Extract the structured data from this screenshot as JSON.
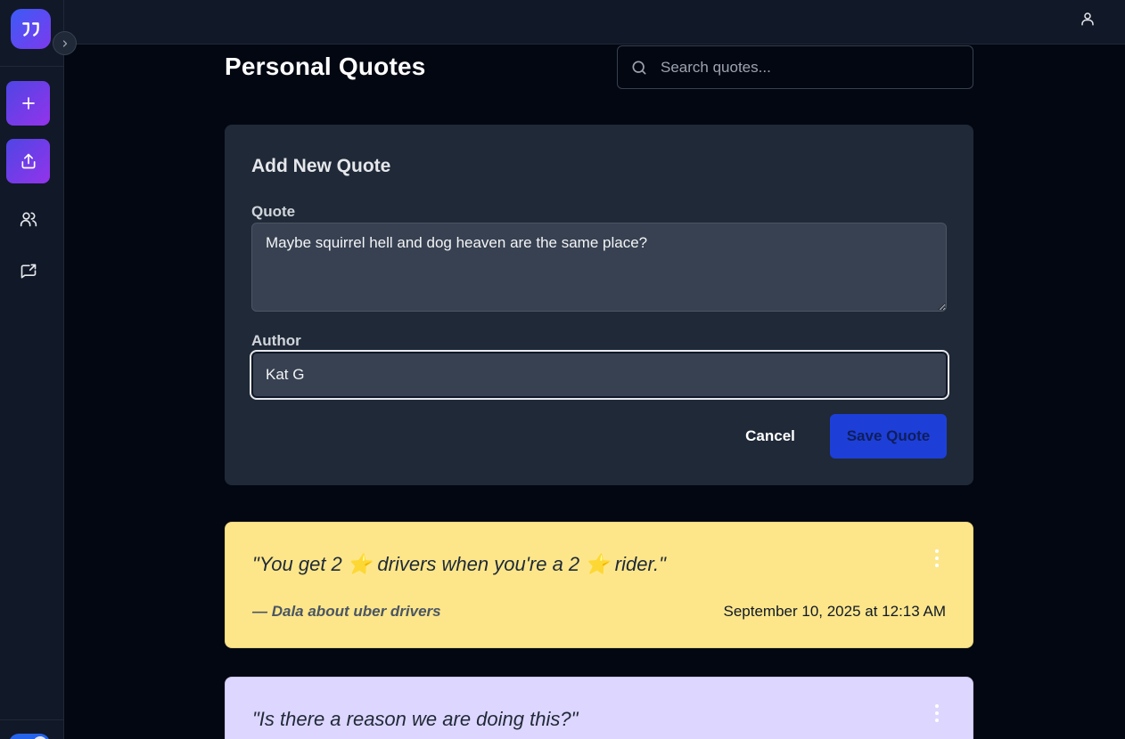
{
  "sidebar": {
    "logo_icon": "quote-marks-icon",
    "collapse_icon": "chevron-right-icon",
    "items": [
      {
        "name": "add-quote-button",
        "icon": "plus-icon"
      },
      {
        "name": "share-button",
        "icon": "upload-icon"
      },
      {
        "name": "people-button",
        "icon": "users-icon"
      },
      {
        "name": "export-chat-button",
        "icon": "message-share-icon"
      }
    ],
    "accent_gradient": [
      "#4f46e5",
      "#9333ea"
    ]
  },
  "header": {
    "title": "Personal Quotes",
    "user_icon": "user-icon"
  },
  "search": {
    "placeholder": "Search quotes...",
    "value": ""
  },
  "form": {
    "title": "Add New Quote",
    "quote_label": "Quote",
    "quote_value": "Maybe squirrel hell and dog heaven are the same place?",
    "author_label": "Author",
    "author_value": "Kat G",
    "cancel_label": "Cancel",
    "save_label": "Save Quote"
  },
  "quotes": [
    {
      "text": "\"You get 2 ⭐ drivers when you're a 2 ⭐ rider.\"",
      "author": "— Dala about uber drivers",
      "date": "September 10, 2025 at 12:13 AM",
      "color": "#fde68a"
    },
    {
      "text": "\"Is there a reason we are doing this?\"",
      "author": "",
      "date": "",
      "color": "#ddd6fe"
    }
  ]
}
